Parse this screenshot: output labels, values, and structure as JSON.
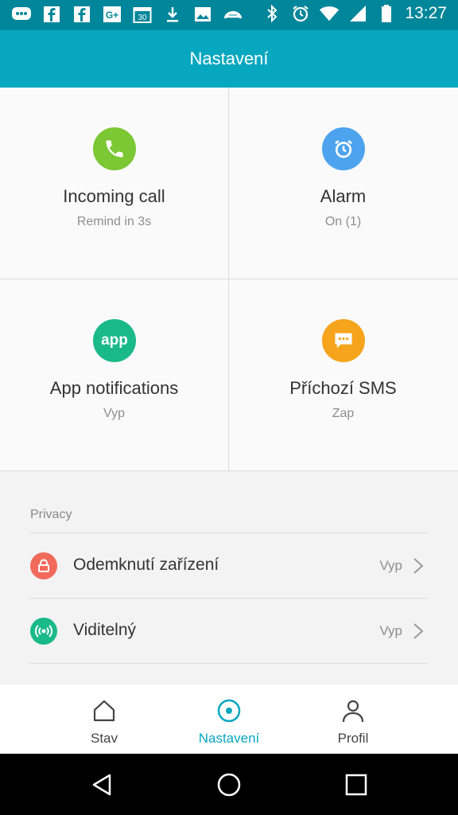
{
  "status_bar": {
    "time": "13:27",
    "icons": [
      "messages-icon",
      "facebook-icon",
      "facebook-icon",
      "google-plus-icon",
      "calendar-icon",
      "download-icon",
      "gallery-icon",
      "cloud-icon",
      "bluetooth-icon",
      "alarm-icon",
      "wifi-icon",
      "signal-icon",
      "battery-icon"
    ],
    "calendar_day": "30"
  },
  "appbar": {
    "title": "Nastavení"
  },
  "tiles": [
    {
      "title": "Incoming call",
      "subtitle": "Remind in 3s",
      "icon": "phone-icon",
      "color": "#7cc734"
    },
    {
      "title": "Alarm",
      "subtitle": "On (1)",
      "icon": "alarm-clock-icon",
      "color": "#4da3ee"
    },
    {
      "title": "App notifications",
      "subtitle": "Vyp",
      "icon": "app-icon",
      "icon_text": "app",
      "color": "#1ab98a"
    },
    {
      "title": "Příchozí SMS",
      "subtitle": "Zap",
      "icon": "sms-icon",
      "color": "#f7a41d"
    }
  ],
  "privacy": {
    "section_label": "Privacy",
    "items": [
      {
        "label": "Odemknutí zařízení",
        "value": "Vyp",
        "icon": "lock-icon",
        "color": "#f16a5b"
      },
      {
        "label": "Viditelný",
        "value": "Vyp",
        "icon": "broadcast-icon",
        "color": "#1ab98a"
      }
    ]
  },
  "bottom_nav": {
    "tabs": [
      {
        "label": "Stav",
        "icon": "home-icon",
        "active": false
      },
      {
        "label": "Nastavení",
        "icon": "settings-dot-icon",
        "active": true
      },
      {
        "label": "Profil",
        "icon": "person-icon",
        "active": false
      }
    ],
    "active_color": "#08a7c0"
  }
}
